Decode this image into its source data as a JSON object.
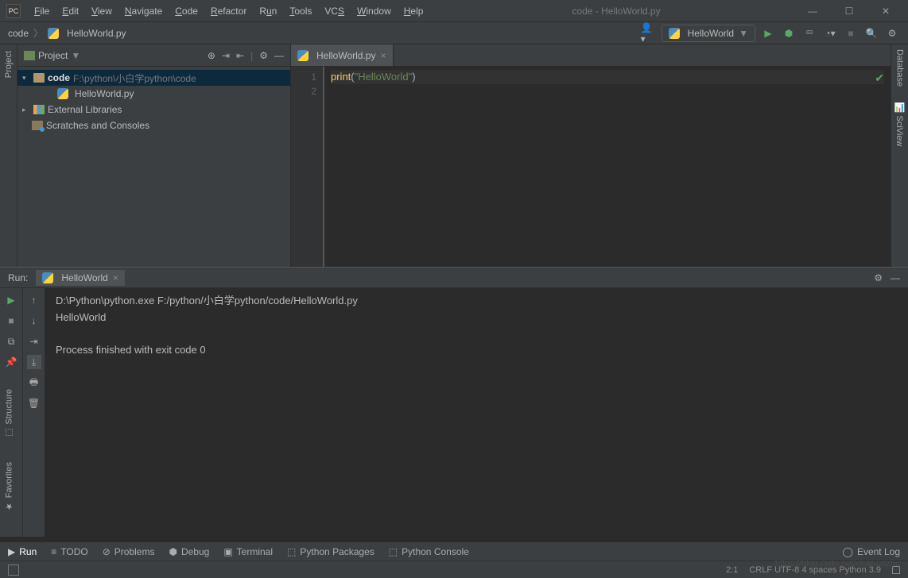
{
  "title": "code - HelloWorld.py",
  "menu": [
    "File",
    "Edit",
    "View",
    "Navigate",
    "Code",
    "Refactor",
    "Run",
    "Tools",
    "VCS",
    "Window",
    "Help"
  ],
  "breadcrumb": {
    "root": "code",
    "file": "HelloWorld.py"
  },
  "runConfig": "HelloWorld",
  "projectPanel": {
    "title": "Project",
    "tree": {
      "root": {
        "name": "code",
        "path": "F:\\python\\小白学python\\code"
      },
      "file": "HelloWorld.py",
      "ext": "External Libraries",
      "scratch": "Scratches and Consoles"
    }
  },
  "editor": {
    "tab": "HelloWorld.py",
    "lines": [
      "1",
      "2"
    ],
    "code": {
      "fn": "print",
      "open": "(",
      "str": "\"HelloWorld\"",
      "close": ")"
    }
  },
  "rightGutter": {
    "a": "Database",
    "b": "SciView"
  },
  "leftGutter": {
    "a": "Project"
  },
  "leftBottom": {
    "a": "Structure",
    "b": "Favorites"
  },
  "run": {
    "title": "Run:",
    "tab": "HelloWorld",
    "out_cmd": "D:\\Python\\python.exe F:/python/小白学python/code/HelloWorld.py",
    "out_line": "HelloWorld",
    "out_exit": "Process finished with exit code 0"
  },
  "bottom": {
    "tabs": [
      "Run",
      "TODO",
      "Problems",
      "Debug",
      "Terminal",
      "Python Packages",
      "Python Console"
    ],
    "eventLog": "Event Log"
  },
  "status": {
    "pos": "2:1",
    "enc": "CRLF  UTF-8  4 spaces  Python 3.9",
    "watermark": "https://blog.csdn.net/chaisuozhu"
  }
}
